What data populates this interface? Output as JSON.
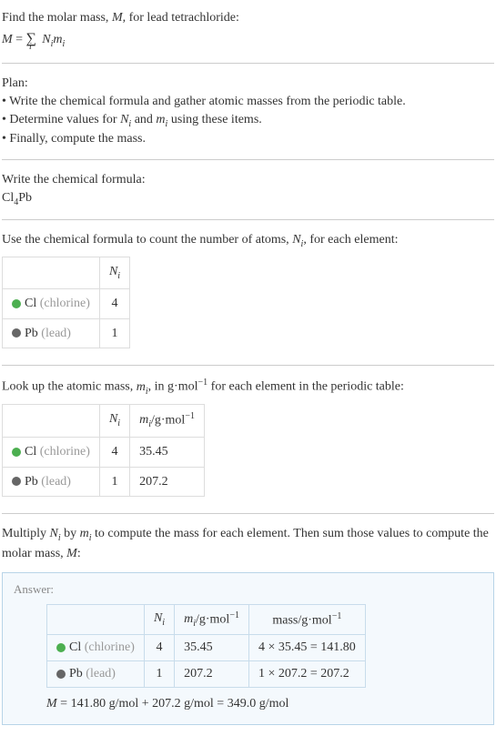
{
  "intro": {
    "line1": "Find the molar mass, M, for lead tetrachloride:",
    "formula": "M = ∑ᵢ Nᵢmᵢ"
  },
  "plan": {
    "title": "Plan:",
    "item1": "• Write the chemical formula and gather atomic masses from the periodic table.",
    "item2": "• Determine values for Nᵢ and mᵢ using these items.",
    "item3": "• Finally, compute the mass."
  },
  "formula_section": {
    "title": "Write the chemical formula:",
    "formula": "Cl₄Pb"
  },
  "count_section": {
    "title": "Use the chemical formula to count the number of atoms, Nᵢ, for each element:",
    "header_ni": "Nᵢ",
    "rows": [
      {
        "dot": "cl",
        "name": "Cl",
        "paren": "(chlorine)",
        "ni": "4"
      },
      {
        "dot": "pb",
        "name": "Pb",
        "paren": "(lead)",
        "ni": "1"
      }
    ]
  },
  "mass_section": {
    "title": "Look up the atomic mass, mᵢ, in g·mol⁻¹ for each element in the periodic table:",
    "header_ni": "Nᵢ",
    "header_mi": "mᵢ/g·mol⁻¹",
    "rows": [
      {
        "dot": "cl",
        "name": "Cl",
        "paren": "(chlorine)",
        "ni": "4",
        "mi": "35.45"
      },
      {
        "dot": "pb",
        "name": "Pb",
        "paren": "(lead)",
        "ni": "1",
        "mi": "207.2"
      }
    ]
  },
  "multiply_section": {
    "title": "Multiply Nᵢ by mᵢ to compute the mass for each element. Then sum those values to compute the molar mass, M:"
  },
  "answer": {
    "label": "Answer:",
    "header_ni": "Nᵢ",
    "header_mi": "mᵢ/g·mol⁻¹",
    "header_mass": "mass/g·mol⁻¹",
    "rows": [
      {
        "dot": "cl",
        "name": "Cl",
        "paren": "(chlorine)",
        "ni": "4",
        "mi": "35.45",
        "mass": "4 × 35.45 = 141.80"
      },
      {
        "dot": "pb",
        "name": "Pb",
        "paren": "(lead)",
        "ni": "1",
        "mi": "207.2",
        "mass": "1 × 207.2 = 207.2"
      }
    ],
    "result": "M = 141.80 g/mol + 207.2 g/mol = 349.0 g/mol"
  }
}
